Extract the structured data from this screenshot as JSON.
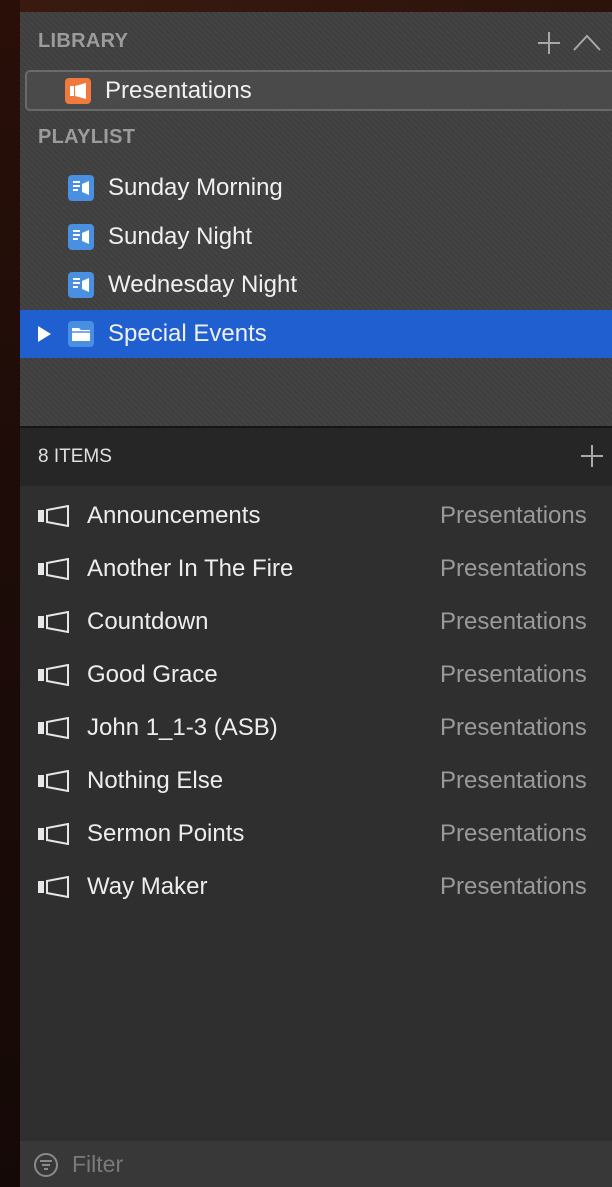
{
  "library": {
    "header": "LIBRARY",
    "items": [
      {
        "label": "Presentations",
        "icon": "presentation-icon",
        "color": "#f07a3e"
      }
    ]
  },
  "playlist": {
    "header": "PLAYLIST",
    "items": [
      {
        "label": "Sunday Morning",
        "icon": "playlist-icon"
      },
      {
        "label": "Sunday Night",
        "icon": "playlist-icon"
      },
      {
        "label": "Wednesday Night",
        "icon": "playlist-icon"
      },
      {
        "label": "Special Events",
        "icon": "folder-icon",
        "selected": true
      }
    ]
  },
  "items_header": {
    "count_label": "8 ITEMS"
  },
  "items": [
    {
      "name": "Announcements",
      "library": "Presentations"
    },
    {
      "name": "Another In The Fire",
      "library": "Presentations"
    },
    {
      "name": "Countdown",
      "library": "Presentations"
    },
    {
      "name": "Good Grace",
      "library": "Presentations"
    },
    {
      "name": "John 1_1-3 (ASB)",
      "library": "Presentations"
    },
    {
      "name": "Nothing Else",
      "library": "Presentations"
    },
    {
      "name": "Sermon Points",
      "library": "Presentations"
    },
    {
      "name": "Way Maker",
      "library": "Presentations"
    }
  ],
  "filter": {
    "placeholder": "Filter"
  },
  "colors": {
    "selection": "#1f5fcf",
    "playlist_icon": "#4a90e2",
    "library_icon": "#f07a3e"
  }
}
